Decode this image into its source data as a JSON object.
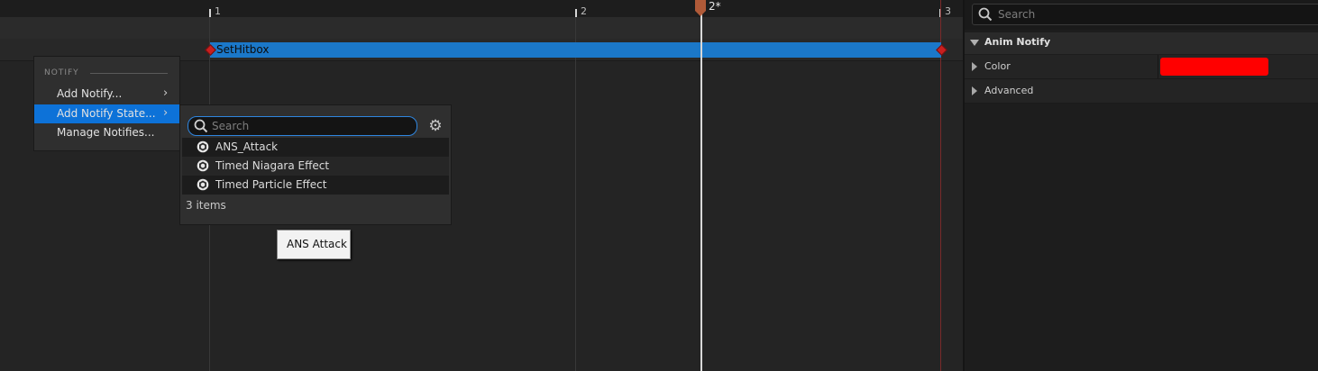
{
  "timeline": {
    "ruler_ticks": [
      "1",
      "2",
      "3"
    ],
    "playhead_label": "2*",
    "notify_name": "SetHitbox"
  },
  "context_menu": {
    "heading": "NOTIFY",
    "items": [
      {
        "label": "Add Notify...",
        "has_submenu": true
      },
      {
        "label": "Add Notify State...",
        "has_submenu": true,
        "selected": true
      },
      {
        "label": "Manage Notifies...",
        "has_submenu": false
      }
    ]
  },
  "submenu": {
    "search_placeholder": "Search",
    "items": [
      "ANS_Attack",
      "Timed Niagara Effect",
      "Timed Particle Effect"
    ],
    "count_text": "3 items"
  },
  "tooltip": {
    "text": "ANS Attack"
  },
  "details": {
    "search_placeholder": "Search",
    "section_title": "Anim Notify",
    "properties": [
      {
        "label": "Color",
        "value_color": "#ff0000"
      },
      {
        "label": "Advanced"
      }
    ]
  },
  "colors": {
    "notify_bar": "#1b78c9",
    "selection": "#0d72d8",
    "playhead": "#b05a38",
    "swatch": "#ff0000"
  }
}
